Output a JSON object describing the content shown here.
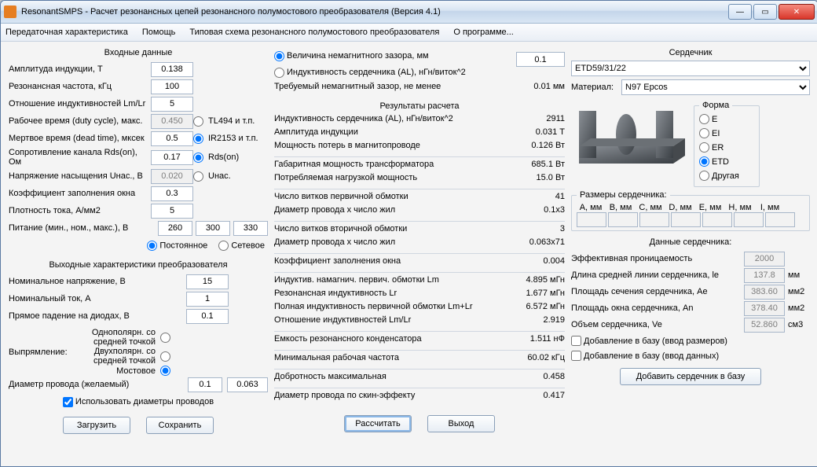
{
  "window": {
    "title": "ResonantSMPS - Расчет резонансных цепей резонансного полумостового преобразователя (Версия 4.1)"
  },
  "menu": {
    "m1": "Передаточная характеристика",
    "m2": "Помощь",
    "m3": "Типовая схема резонансного полумостового преобразователя",
    "m4": "О программе..."
  },
  "input": {
    "title": "Входные данные",
    "amp_b": {
      "label": "Амплитуда индукции, Т",
      "val": "0.138"
    },
    "fres": {
      "label": "Резонансная частота, кГц",
      "val": "100"
    },
    "lmlr": {
      "label": "Отношение индуктивностей Lm/Lr",
      "val": "5"
    },
    "duty": {
      "label": "Рабочее время (duty cycle), макс.",
      "val": "0.450"
    },
    "dead": {
      "label": "Мертвое время (dead time), мксек",
      "val": "0.5"
    },
    "rds": {
      "label": "Сопротивление канала Rds(on), Ом",
      "val": "0.17"
    },
    "usat": {
      "label": "Напряжение насыщения Uнас., В",
      "val": "0.020"
    },
    "kfill": {
      "label": "Коэффициент заполнения окна",
      "val": "0.3"
    },
    "jdens": {
      "label": "Плотность тока, А/мм2",
      "val": "5"
    },
    "power": {
      "label": "Питание (мин., ном., макс.), В",
      "v1": "260",
      "v2": "300",
      "v3": "330"
    },
    "drv1": "TL494 и т.п.",
    "drv2": "IR2153 и т.п.",
    "drv3": "Rds(on)",
    "drv4": "Uнас.",
    "src1": "Постоянное",
    "src2": "Сетевое"
  },
  "output": {
    "title": "Выходные характеристики преобразователя",
    "vnom": {
      "label": "Номинальное напряжение, В",
      "val": "15"
    },
    "inom": {
      "label": "Номинальный ток, А",
      "val": "1"
    },
    "vdiode": {
      "label": "Прямое падение на диодах, В",
      "val": "0.1"
    },
    "rect_label": "Выпрямление:",
    "rect1": "Однополярн. со средней точкой",
    "rect2": "Двухполярн. со средней точкой",
    "rect3": "Мостовое",
    "wire": {
      "label": "Диаметр провода (желаемый)",
      "v1": "0.1",
      "v2": "0.063"
    },
    "use_dia": "Использовать диаметры проводов"
  },
  "buttons": {
    "load": "Загрузить",
    "save": "Сохранить",
    "calc": "Рассчитать",
    "exit": "Выход",
    "addcore": "Добавить сердечник в базу"
  },
  "gap": {
    "r1": "Величина немагнитного зазора, мм",
    "r2": "Индуктивность сердечника (AL), нГн/виток^2",
    "val": "0.1",
    "req_label": "Требуемый немагнитный зазор, не менее",
    "req_val": "0.01 мм"
  },
  "results": {
    "title": "Результаты расчета",
    "rows": [
      {
        "l": "Индуктивность сердечника (AL), нГн/виток^2",
        "v": "2911"
      },
      {
        "l": "Амплитуда индукции",
        "v": "0.031 Т"
      },
      {
        "l": "Мощность потерь в магнитопроводе",
        "v": "0.126 Вт"
      },
      {
        "sep": true
      },
      {
        "l": "Габаритная мощность трансформатора",
        "v": "685.1 Вт"
      },
      {
        "l": "Потребляемая нагрузкой мощность",
        "v": "15.0 Вт"
      },
      {
        "sep": true
      },
      {
        "l": "Число витков первичной обмотки",
        "v": "41"
      },
      {
        "l": "Диаметр провода x число жил",
        "v": "0.1x3"
      },
      {
        "sep": true
      },
      {
        "l": "Число витков вторичной обмотки",
        "v": "3"
      },
      {
        "l": "Диаметр провода x число жил",
        "v": "0.063x71"
      },
      {
        "sep": true
      },
      {
        "l": "Коэффициент заполнения окна",
        "v": "0.004"
      },
      {
        "sep": true
      },
      {
        "l": "Индуктив. намагнич. первич. обмотки Lm",
        "v": "4.895 мГн"
      },
      {
        "l": "Резонансная индуктивность Lr",
        "v": "1.677 мГн"
      },
      {
        "l": "Полная индуктивность первичной обмотки  Lm+Lr",
        "v": "6.572 мГн"
      },
      {
        "l": "Отношение индуктивностей Lm/Lr",
        "v": "2.919"
      },
      {
        "sep": true
      },
      {
        "l": "Емкость резонансного конденсатора",
        "v": "1.511 нФ"
      },
      {
        "sep": true
      },
      {
        "l": "Минимальная рабочая частота",
        "v": "60.02 кГц"
      },
      {
        "sep": true
      },
      {
        "l": "Добротность максимальная",
        "v": "0.458"
      },
      {
        "sep": true
      },
      {
        "l": "Диаметр провода по скин-эффекту",
        "v": "0.417"
      }
    ]
  },
  "core": {
    "title": "Сердечник",
    "select": "ETD59/31/22",
    "mat_label": "Материал:",
    "mat": "N97 Epcos",
    "shape_title": "Форма",
    "shapes": {
      "e": "E",
      "ei": "EI",
      "er": "ER",
      "etd": "ETD",
      "other": "Другая"
    },
    "dims_title": "Размеры сердечника:",
    "dims_head": [
      "A, мм",
      "B, мм",
      "C, мм",
      "D, мм",
      "E, мм",
      "H, мм",
      "I, мм"
    ],
    "data_title": "Данные сердечника:",
    "mu": {
      "label": "Эффективная проницаемость",
      "val": "2000",
      "unit": ""
    },
    "le": {
      "label": "Длина средней линии сердечника, le",
      "val": "137.8",
      "unit": "мм"
    },
    "ae": {
      "label": "Площадь сечения сердечника, Ae",
      "val": "383.60",
      "unit": "мм2"
    },
    "an": {
      "label": "Площадь окна сердечника, An",
      "val": "378.40",
      "unit": "мм2"
    },
    "ve": {
      "label": "Объем сердечника, Ve",
      "val": "52.860",
      "unit": "см3"
    },
    "add1": "Добавление в базу (ввод размеров)",
    "add2": "Добавление в базу (ввод данных)"
  }
}
